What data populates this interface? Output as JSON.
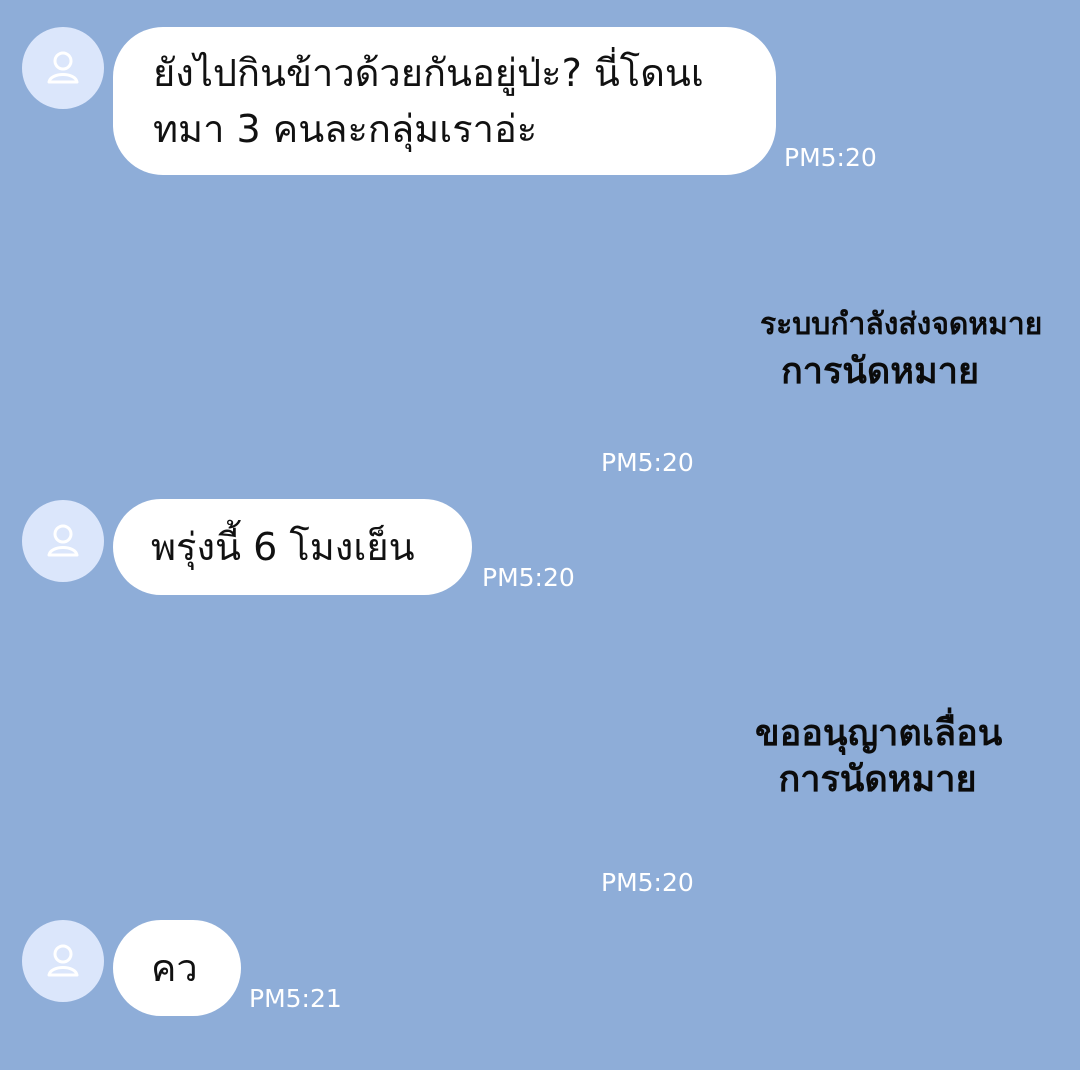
{
  "messages": [
    {
      "kind": "received_text",
      "lines": [
        "ยังไปกินข้าวด้วยกันอยู่ป่ะ? นี่โดนเ",
        "ทมา 3 คนละกลุ่มเราอ่ะ"
      ],
      "time": "PM5:20",
      "avatar_icon": "person-icon"
    },
    {
      "kind": "sticker",
      "lines": [
        "ระบบกำลังส่งจดหมาย",
        "การนัดหมาย"
      ],
      "time": "PM5:20"
    },
    {
      "kind": "received_text",
      "text": "พรุ่งนี้ 6 โมงเย็น",
      "time": "PM5:20",
      "avatar_icon": "person-icon"
    },
    {
      "kind": "sticker",
      "lines": [
        "ขออนุญาตเลื่อน",
        "การนัดหมาย"
      ],
      "time": "PM5:20"
    },
    {
      "kind": "received_text",
      "text": "คว",
      "time": "PM5:21",
      "avatar_icon": "person-icon"
    }
  ],
  "colors": {
    "background": "#8eadd8",
    "bubble": "#ffffff",
    "avatar_bg": "#dbe6fb",
    "timestamp": "#ffffff"
  }
}
